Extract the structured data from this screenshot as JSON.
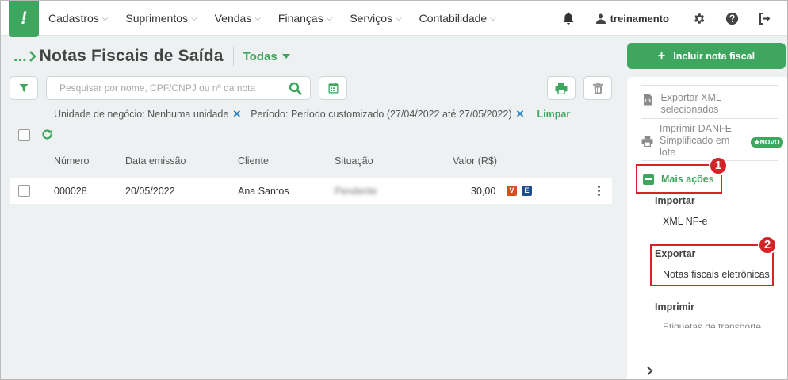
{
  "app": {
    "logo_text": "!",
    "brand_color": "#3ea65f",
    "highlight_color": "#d5232a"
  },
  "nav": {
    "items": [
      {
        "label": "Cadastros"
      },
      {
        "label": "Suprimentos"
      },
      {
        "label": "Vendas"
      },
      {
        "label": "Finanças"
      },
      {
        "label": "Serviços"
      },
      {
        "label": "Contabilidade"
      }
    ],
    "user": "treinamento",
    "icons": [
      "bell-icon",
      "user-icon",
      "gear-icon",
      "help-icon",
      "logout-icon"
    ]
  },
  "header": {
    "breadcrumb": "...",
    "title": "Notas Fiscais de Saída",
    "filter_label": "Todas"
  },
  "toolbar": {
    "search_placeholder": "Pesquisar por nome, CPF/CNPJ ou nº da nota"
  },
  "filters": {
    "chips": [
      {
        "label": "Unidade de negócio: Nenhuma unidade"
      },
      {
        "label": "Período: Período customizado (27/04/2022 até 27/05/2022)"
      }
    ],
    "remove_symbol": "✕",
    "clear_label": "Limpar"
  },
  "table": {
    "columns": [
      "Número",
      "Data emissão",
      "Cliente",
      "Situação",
      "Valor (R$)"
    ],
    "rows": [
      {
        "numero": "000028",
        "data": "20/05/2022",
        "cliente": "Ana Santos",
        "situacao": "Pendente",
        "valor": "30,00",
        "badges": [
          "V",
          "E"
        ]
      }
    ]
  },
  "sidebar": {
    "add_button": "Incluir nota fiscal",
    "items": [
      {
        "label": "Exportar XML selecionados",
        "icon": "xml-file-icon"
      },
      {
        "label": "Imprimir DANFE Simplificado em lote",
        "icon": "printer-icon",
        "badge": "★NOVO"
      }
    ],
    "more_actions": "Mais ações",
    "sections": [
      {
        "title": "Importar",
        "items": [
          "XML NF-e"
        ]
      },
      {
        "title": "Exportar",
        "items": [
          "Notas fiscais eletrônicas"
        ]
      },
      {
        "title": "Imprimir",
        "items": [
          "Etiquetas de transporte"
        ]
      }
    ]
  },
  "callouts": [
    "1",
    "2"
  ]
}
